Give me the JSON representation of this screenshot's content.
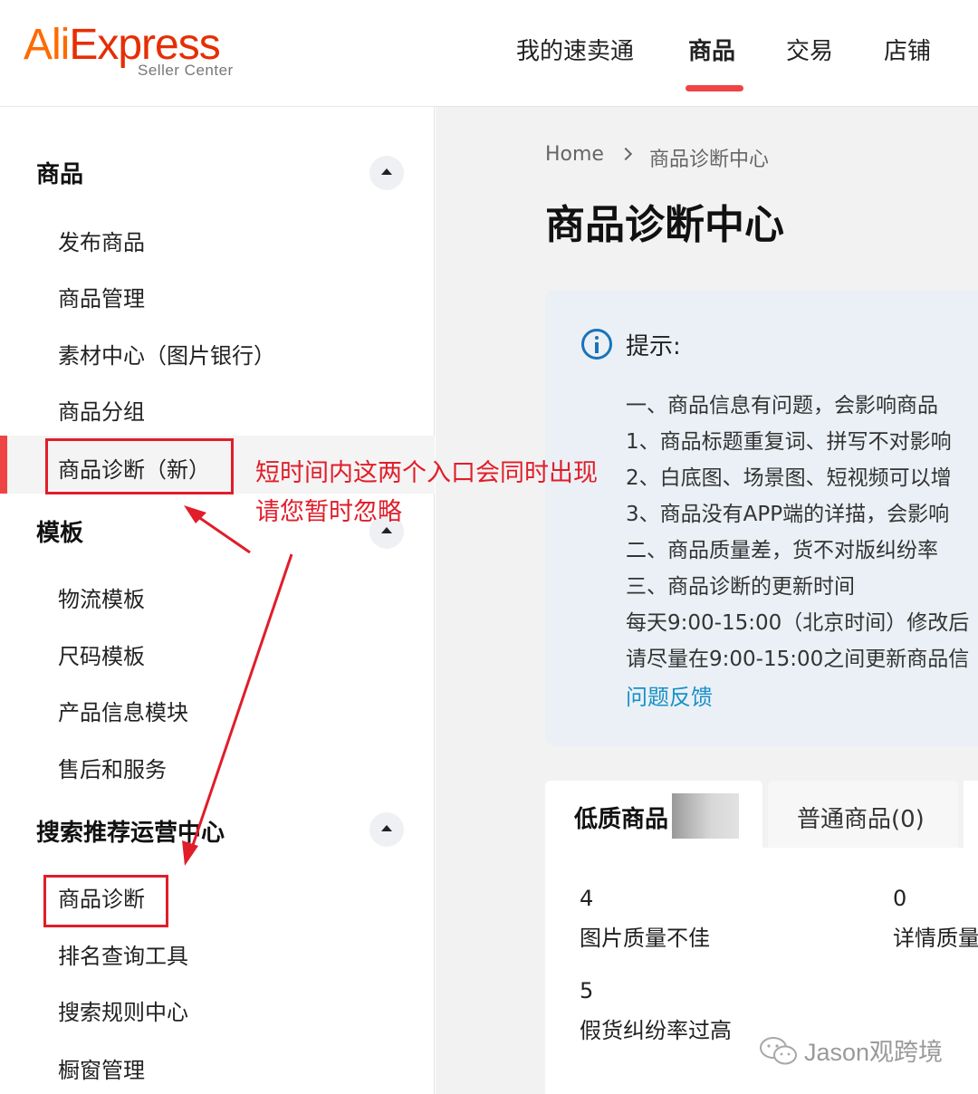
{
  "logo": {
    "brand": "AliExpress",
    "sub": "Seller Center"
  },
  "topnav": {
    "items": [
      "我的速卖通",
      "商品",
      "交易",
      "店铺"
    ],
    "active": "商品"
  },
  "sidebar": {
    "sections": [
      {
        "title": "商品",
        "items": [
          "发布商品",
          "商品管理",
          "素材中心（图片银行）",
          "商品分组",
          "商品诊断（新）"
        ]
      },
      {
        "title": "模板",
        "items": [
          "物流模板",
          "尺码模板",
          "产品信息模块",
          "售后和服务"
        ]
      },
      {
        "title": "搜索推荐运营中心",
        "items": [
          "商品诊断",
          "排名查询工具",
          "搜索规则中心",
          "橱窗管理"
        ]
      }
    ],
    "active_item": "商品诊断（新）"
  },
  "breadcrumb": {
    "home": "Home",
    "current": "商品诊断中心"
  },
  "page_title": "商品诊断中心",
  "tip": {
    "title": "提示:",
    "lines": [
      "一、商品信息有问题，会影响商品",
      "1、商品标题重复词、拼写不对影响",
      "2、白底图、场景图、短视频可以增",
      "3、商品没有APP端的详描，会影响",
      "二、商品质量差，货不对版纠纷率",
      "三、商品诊断的更新时间",
      "每天9:00-15:00（北京时间）修改后",
      "请尽量在9:00-15:00之间更新商品信"
    ],
    "link": "问题反馈"
  },
  "tabs": [
    {
      "label": "低质商品"
    },
    {
      "label": "普通商品(0)"
    }
  ],
  "stats": [
    {
      "count": "4",
      "label": "图片质量不佳"
    },
    {
      "count": "0",
      "label": "详情质量"
    },
    {
      "count": "5",
      "label": "假货纠纷率过高"
    }
  ],
  "annotation": {
    "line1": "短时间内这两个入口会同时出现",
    "line2": "请您暂时忽略",
    "color": "#e11d2a"
  },
  "watermark": {
    "text": "Jason观跨境"
  }
}
